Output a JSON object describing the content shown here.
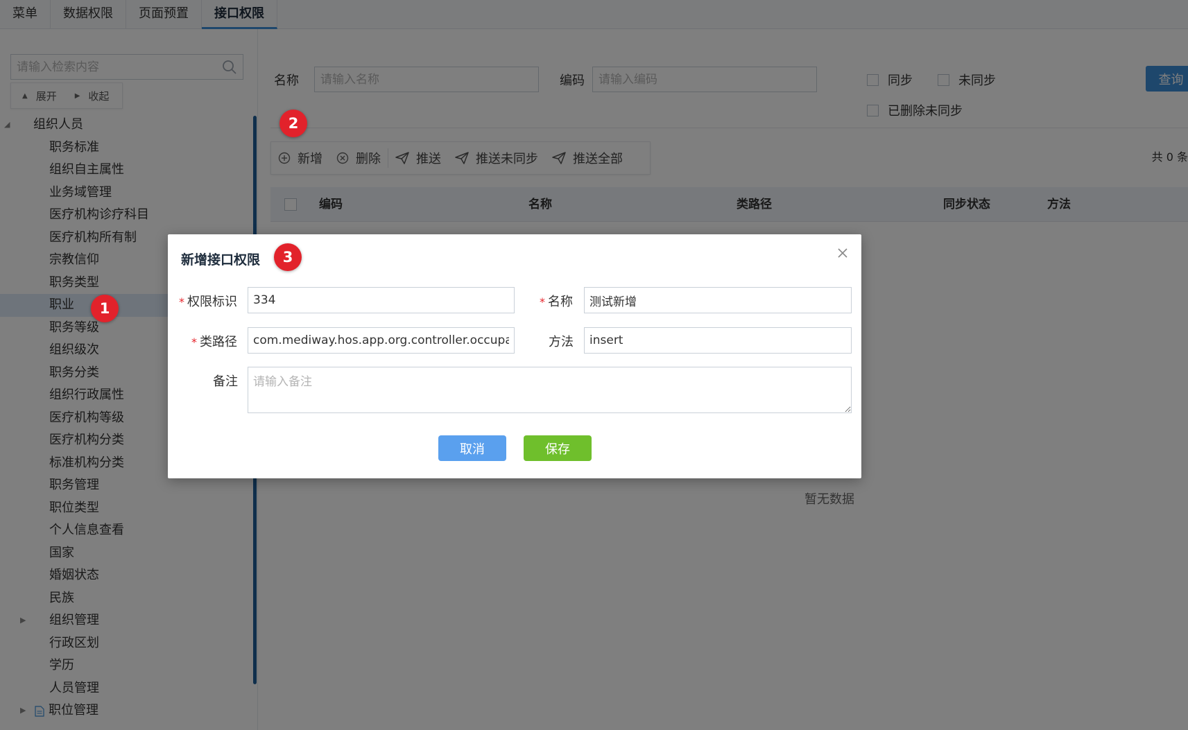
{
  "tabs": [
    {
      "label": "菜单"
    },
    {
      "label": "数据权限"
    },
    {
      "label": "页面预置"
    },
    {
      "label": "接口权限",
      "active": true
    }
  ],
  "left": {
    "search_placeholder": "请输入检索内容",
    "expand_label": "展开",
    "collapse_label": "收起",
    "tree": [
      {
        "label": "组织人员",
        "level": "root"
      },
      {
        "label": "职务标准",
        "level": "child"
      },
      {
        "label": "组织自主属性",
        "level": "child"
      },
      {
        "label": "业务域管理",
        "level": "child"
      },
      {
        "label": "医疗机构诊疗科目",
        "level": "child"
      },
      {
        "label": "医疗机构所有制",
        "level": "child"
      },
      {
        "label": "宗教信仰",
        "level": "child"
      },
      {
        "label": "职务类型",
        "level": "child"
      },
      {
        "label": "职业",
        "level": "child",
        "selected": true
      },
      {
        "label": "职务等级",
        "level": "child"
      },
      {
        "label": "组织级次",
        "level": "child"
      },
      {
        "label": "职务分类",
        "level": "child"
      },
      {
        "label": "组织行政属性",
        "level": "child"
      },
      {
        "label": "医疗机构等级",
        "level": "child"
      },
      {
        "label": "医疗机构分类",
        "level": "child"
      },
      {
        "label": "标准机构分类",
        "level": "child"
      },
      {
        "label": "职务管理",
        "level": "child"
      },
      {
        "label": "职位类型",
        "level": "child"
      },
      {
        "label": "个人信息查看",
        "level": "child"
      },
      {
        "label": "国家",
        "level": "child"
      },
      {
        "label": "婚姻状态",
        "level": "child"
      },
      {
        "label": "民族",
        "level": "child"
      },
      {
        "label": "组织管理",
        "level": "child",
        "collapsed": true
      },
      {
        "label": "行政区划",
        "level": "child"
      },
      {
        "label": "学历",
        "level": "child"
      },
      {
        "label": "人员管理",
        "level": "child"
      },
      {
        "label": "职位管理",
        "level": "child",
        "collapsed": true,
        "file_icon": true
      }
    ]
  },
  "filter": {
    "name_label": "名称",
    "name_placeholder": "请输入名称",
    "code_label": "编码",
    "code_placeholder": "请输入编码",
    "chk_synced": "同步",
    "chk_unsynced": "未同步",
    "chk_deleted_unsynced": "已删除未同步",
    "query_label": "查询"
  },
  "toolbar": {
    "add": "新增",
    "delete": "删除",
    "push": "推送",
    "push_unsynced": "推送未同步",
    "push_all": "推送全部"
  },
  "count_text": "共 0 条",
  "table": {
    "columns": [
      "编码",
      "名称",
      "类路径",
      "同步状态",
      "方法"
    ],
    "empty_text": "暂无数据"
  },
  "modal": {
    "title": "新增接口权限",
    "fields": {
      "permission_id_label": "权限标识",
      "permission_id_value": "334",
      "name_label": "名称",
      "name_value": "测试新增",
      "class_path_label": "类路径",
      "class_path_value": "com.mediway.hos.app.org.controller.occupa",
      "method_label": "方法",
      "method_value": "insert",
      "remark_label": "备注",
      "remark_placeholder": "请输入备注"
    },
    "cancel_label": "取消",
    "save_label": "保存"
  },
  "badges": [
    "1",
    "2",
    "3"
  ],
  "colors": {
    "accent": "#3d8ed8",
    "save": "#6fbf2c",
    "cancel": "#5aa0ee",
    "badge": "#e2222b",
    "required": "#e6252c"
  }
}
